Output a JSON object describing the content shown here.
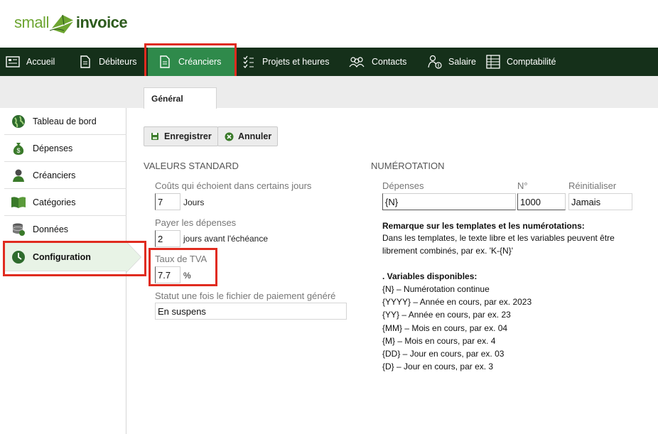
{
  "logo": {
    "word1": "small",
    "word2": "invoice"
  },
  "nav": [
    {
      "label": "Accueil",
      "icon": "dashboard-icon"
    },
    {
      "label": "Débiteurs",
      "icon": "document-icon"
    },
    {
      "label": "Créanciers",
      "icon": "document-icon",
      "active": true
    },
    {
      "label": "Projets et heures",
      "icon": "checklist-icon"
    },
    {
      "label": "Contacts",
      "icon": "people-icon"
    },
    {
      "label": "Salaire",
      "icon": "salary-icon"
    },
    {
      "label": "Comptabilité",
      "icon": "ledger-icon"
    }
  ],
  "tab": {
    "label": "Général"
  },
  "sidebar": [
    {
      "label": "Tableau de bord",
      "icon": "globe-icon"
    },
    {
      "label": "Dépenses",
      "icon": "money-bag-icon"
    },
    {
      "label": "Créanciers",
      "icon": "user-icon"
    },
    {
      "label": "Catégories",
      "icon": "book-icon"
    },
    {
      "label": "Données",
      "icon": "database-icon"
    },
    {
      "label": "Configuration",
      "icon": "clock-icon",
      "active": true
    }
  ],
  "toolbar": {
    "save": "Enregistrer",
    "cancel": "Annuler"
  },
  "standard": {
    "title": "VALEURS STANDARD",
    "due_label": "Coûts qui échoient dans certains jours",
    "due_value": "7",
    "due_unit": "Jours",
    "pay_label": "Payer les dépenses",
    "pay_value": "2",
    "pay_unit": "jours avant l'échéance",
    "tva_label": "Taux de TVA",
    "tva_value": "7.7",
    "tva_unit": "%",
    "status_label": "Statut une fois le fichier de paiement généré",
    "status_value": "En suspens"
  },
  "numbering": {
    "title": "NUMÉROTATION",
    "col_expenses": "Dépenses",
    "col_number": "N°",
    "col_reset": "Réinitialiser",
    "expenses_value": "{N}",
    "number_value": "1000",
    "reset_value": "Jamais",
    "remark_title": "Remarque sur les templates et les numérotations:",
    "remark_line1": "Dans les templates, le texte libre et les variables peuvent être",
    "remark_line2": "librement combinés, par ex. 'K-{N}'",
    "vars_title": ". Variables disponibles:",
    "vars": [
      "{N} – Numérotation continue",
      "{YYYY} – Année en cours, par ex. 2023",
      "{YY} – Année en cours, par ex. 23",
      "{MM} – Mois en cours, par ex. 04",
      "{M} – Mois en cours, par ex. 4",
      "{DD} – Jour en cours, par ex. 03",
      "{D} – Jour en cours, par ex. 3"
    ]
  },
  "colors": {
    "nav_bg": "#15301a",
    "nav_active": "#2f8a4b",
    "highlight": "#e02b1f",
    "sidebar_active": "#e8f3e6"
  }
}
